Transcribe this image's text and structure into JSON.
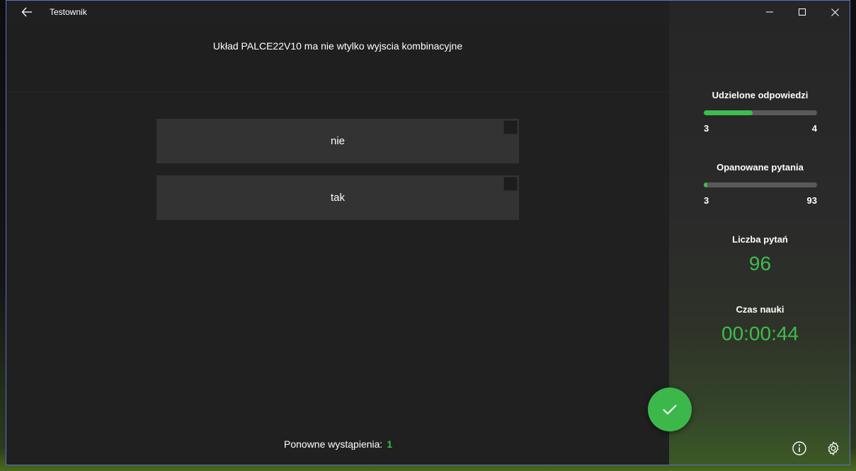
{
  "app": {
    "title": "Testownik"
  },
  "question": {
    "text": "Układ PALCE22V10 ma nie wtylko wyjscia kombinacyjne"
  },
  "answers": [
    {
      "label": "nie",
      "checked": false
    },
    {
      "label": "tak",
      "checked": false
    }
  ],
  "occurrences": {
    "label": "Ponowne wystąpienia:",
    "value": "1"
  },
  "stats": {
    "answered": {
      "title": "Udzielone odpowiedzi",
      "min": "3",
      "max": "4",
      "progress": 0.43
    },
    "mastered": {
      "title": "Opanowane pytania",
      "min": "3",
      "max": "93",
      "progress": 0.03
    },
    "question_count": {
      "title": "Liczba pytań",
      "value": "96"
    },
    "study_time": {
      "title": "Czas nauki",
      "value": "00:00:44"
    }
  },
  "colors": {
    "accent": "#3dbd4e",
    "window_border": "#5a70c8",
    "answer_bg": "#333333"
  },
  "icons": {
    "back": "back-arrow-icon",
    "minimize": "minimize-icon",
    "maximize": "maximize-icon",
    "close": "close-icon",
    "submit": "checkmark-icon",
    "info": "info-icon",
    "settings": "gear-icon"
  }
}
